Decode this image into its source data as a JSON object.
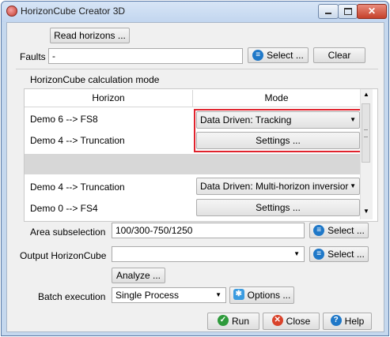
{
  "window": {
    "title": "HorizonCube Creator 3D",
    "close_glyph": "✕"
  },
  "read_horizons_label": "Read horizons ...",
  "faults": {
    "label": "Faults",
    "value": "-",
    "select_label": "Select ...",
    "clear_label": "Clear"
  },
  "calc_mode": {
    "title": "HorizonCube calculation mode",
    "columns": [
      "Horizon",
      "Mode"
    ],
    "rows": [
      {
        "horizon": "Demo 6 --> FS8",
        "mode": "Data Driven: Tracking"
      },
      {
        "horizon": "Demo 4 --> Truncation",
        "mode": "Settings ..."
      },
      {
        "horizon": "Demo 4 --> Truncation",
        "mode": "Data Driven: Multi-horizon inversior"
      },
      {
        "horizon": "Demo 0 --> FS4",
        "mode": "Settings ..."
      }
    ]
  },
  "area": {
    "label": "Area subselection",
    "value": "100/300-750/1250",
    "select_label": "Select ..."
  },
  "output": {
    "label": "Output HorizonCube",
    "value": "",
    "select_label": "Select ..."
  },
  "analyze_label": "Analyze ...",
  "batch": {
    "label": "Batch execution",
    "value": "Single Process",
    "options_label": "Options ..."
  },
  "footer": {
    "run_label": "Run",
    "close_label": "Close",
    "help_label": "Help"
  },
  "colors": {
    "accent": "#1f78c8",
    "highlight": "#e0232d",
    "run": "#2e9b3c",
    "close": "#d9432b"
  }
}
